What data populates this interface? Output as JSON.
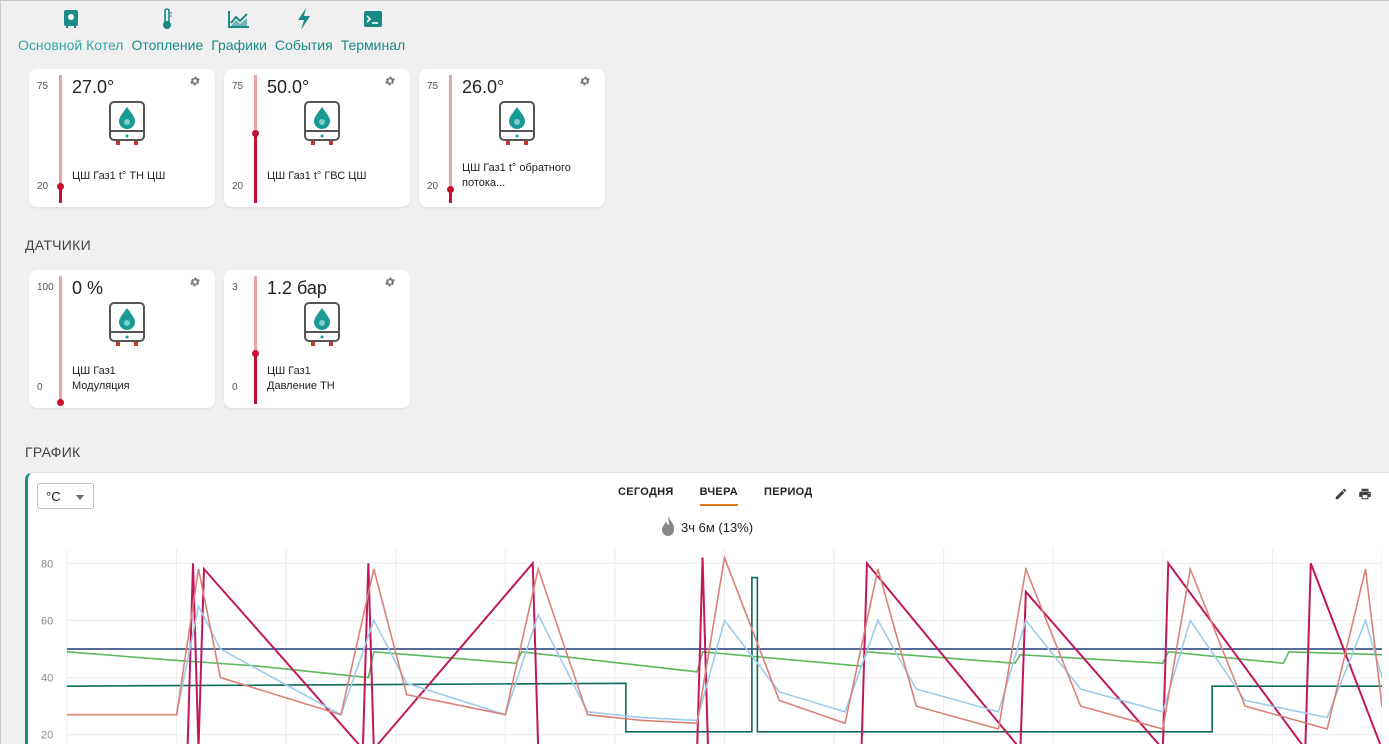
{
  "nav": {
    "items": [
      {
        "label": "Основной Котел",
        "icon": "boiler-icon"
      },
      {
        "label": "Отопление",
        "icon": "thermometer-icon"
      },
      {
        "label": "Графики",
        "icon": "area-chart-icon"
      },
      {
        "label": "События",
        "icon": "lightning-icon"
      },
      {
        "label": "Терминал",
        "icon": "terminal-icon"
      }
    ]
  },
  "temperature_cards": [
    {
      "max": "75",
      "min": "20",
      "value": "27.0°",
      "name": "ЦШ Газ1 t° ТН ЦШ",
      "level": 0.13
    },
    {
      "max": "75",
      "min": "20",
      "value": "50.0°",
      "name": "ЦШ Газ1 t° ГВС ЦШ",
      "level": 0.55
    },
    {
      "max": "75",
      "min": "20",
      "value": "26.0°",
      "name": "ЦШ Газ1 t° обратного потока...",
      "level": 0.11
    }
  ],
  "sensors": {
    "title": "ДАТЧИКИ",
    "cards": [
      {
        "max": "100",
        "min": "0",
        "value": "0 %",
        "name": "ЦШ Газ1 Модуляция",
        "level": 0.0
      },
      {
        "max": "3",
        "min": "0",
        "value": "1.2 бар",
        "name": "ЦШ Газ1 Давление ТН",
        "level": 0.4
      }
    ]
  },
  "chart_section": {
    "title": "ГРАФИК",
    "unit": "°C",
    "tabs": [
      "СЕГОДНЯ",
      "ВЧЕРА",
      "ПЕРИОД"
    ],
    "active_tab": "ВЧЕРА",
    "burn_time": "3ч 6м (13%)"
  },
  "colors": {
    "accent": "#1a8a86",
    "bar_fill": "#c8102e",
    "series_navy": "#1f3d7a",
    "series_green": "#5cb85c",
    "series_teal": "#0e6b5a",
    "series_magenta": "#c2185b",
    "series_lightblue": "#9ecbec",
    "series_salmon": "#d98277"
  },
  "chart_data": {
    "type": "line",
    "ylim": [
      15,
      85
    ],
    "yticks": [
      20,
      40,
      60,
      80
    ],
    "xlim": [
      0,
      24
    ],
    "series": [
      {
        "color": "navy",
        "x": [
          0,
          24
        ],
        "y": [
          50,
          50
        ]
      },
      {
        "color": "green",
        "x": [
          0,
          2,
          3.5,
          5.5,
          5.6,
          8.2,
          8.3,
          11.5,
          11.6,
          14.5,
          14.6,
          17.3,
          17.4,
          20.0,
          20.1,
          22.2,
          22.3,
          24
        ],
        "y": [
          49,
          46,
          44,
          40,
          49,
          45,
          49,
          42,
          49,
          44,
          49,
          45,
          48,
          45,
          49,
          45,
          49,
          48
        ]
      },
      {
        "color": "teal",
        "x": [
          0,
          10.2,
          10.2,
          12.5,
          12.5,
          12.6,
          12.6,
          20.9,
          20.9,
          24
        ],
        "y": [
          37,
          38,
          21,
          21,
          75,
          75,
          21,
          21,
          37,
          37
        ]
      },
      {
        "color": "magenta",
        "x": [
          0,
          2.2,
          2.3,
          2.4,
          2.5,
          5.4,
          5.5,
          5.6,
          8.5,
          8.6,
          11.5,
          11.6,
          11.7,
          14.5,
          14.6,
          17.4,
          17.5,
          20.0,
          20.1,
          22.6,
          22.7,
          24
        ],
        "y": [
          15,
          15,
          80,
          15,
          78,
          15,
          80,
          15,
          80,
          15,
          15,
          82,
          15,
          15,
          80,
          15,
          70,
          15,
          80,
          15,
          80,
          15
        ]
      },
      {
        "color": "lightblue",
        "x": [
          0,
          2,
          2.4,
          2.8,
          5.0,
          5.6,
          6.2,
          8.0,
          8.6,
          9.5,
          10.5,
          11.5,
          12.0,
          13.0,
          14.2,
          14.8,
          15.5,
          17.0,
          17.5,
          18.5,
          20.0,
          20.5,
          21.5,
          23.0,
          23.7,
          24
        ],
        "y": [
          27,
          27,
          65,
          50,
          27,
          60,
          38,
          27,
          62,
          28,
          26,
          25,
          60,
          35,
          28,
          60,
          36,
          28,
          60,
          36,
          28,
          60,
          32,
          26,
          60,
          40
        ]
      },
      {
        "color": "salmon",
        "x": [
          0,
          2,
          2.4,
          2.8,
          5.0,
          5.6,
          6.2,
          8.0,
          8.6,
          9.5,
          10.5,
          11.5,
          12.0,
          13.0,
          14.2,
          14.8,
          15.5,
          17.0,
          17.5,
          18.5,
          20.0,
          20.5,
          21.5,
          23.0,
          23.7,
          24
        ],
        "y": [
          27,
          27,
          78,
          40,
          27,
          78,
          34,
          27,
          78,
          27,
          25,
          24,
          82,
          32,
          24,
          78,
          30,
          22,
          78,
          30,
          22,
          78,
          30,
          22,
          78,
          30
        ]
      }
    ]
  }
}
